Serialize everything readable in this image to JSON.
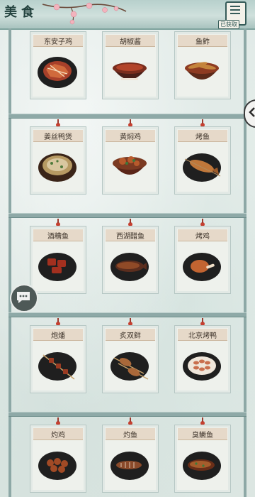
{
  "header": {
    "title": "美食",
    "menu_tag": "已获取"
  },
  "rows": [
    {
      "items": [
        {
          "name": "东安子鸡",
          "dish": "chicken-plate"
        },
        {
          "name": "胡椒酱",
          "dish": "pepper-sauce-bowl"
        },
        {
          "name": "鱼鲊",
          "dish": "fish-bowl"
        }
      ]
    },
    {
      "items": [
        {
          "name": "姜丝鸭煲",
          "dish": "duck-pot"
        },
        {
          "name": "黄焖鸡",
          "dish": "braised-chicken-bowl"
        },
        {
          "name": "烤鱼",
          "dish": "grilled-fish"
        }
      ]
    },
    {
      "items": [
        {
          "name": "酒糟鱼",
          "dish": "wine-fish"
        },
        {
          "name": "西湖醋鱼",
          "dish": "vinegar-fish"
        },
        {
          "name": "烤鸡",
          "dish": "roast-chicken"
        }
      ]
    },
    {
      "items": [
        {
          "name": "炮燔",
          "dish": "skewer"
        },
        {
          "name": "炙双鲜",
          "dish": "double-skewer"
        },
        {
          "name": "北京烤鸭",
          "dish": "peking-duck"
        }
      ]
    },
    {
      "items": [
        {
          "name": "灼鸡",
          "dish": "boiled-chicken"
        },
        {
          "name": "灼鱼",
          "dish": "boiled-fish"
        },
        {
          "name": "臭鳜鱼",
          "dish": "stinky-mandarin-fish"
        }
      ]
    }
  ],
  "colors": {
    "accent": "#c63f2f",
    "frame": "#8da8a6",
    "card": "#eef1ec",
    "name_bar": "#e6d9c9"
  }
}
